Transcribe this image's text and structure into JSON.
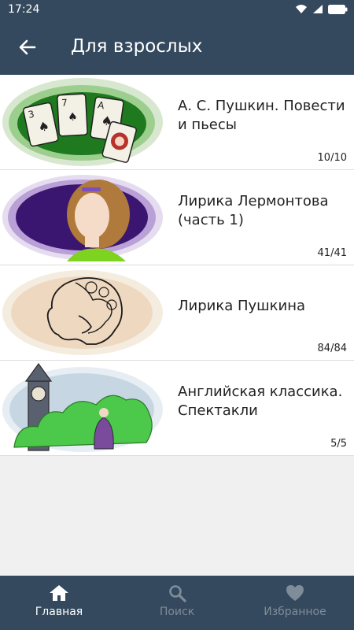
{
  "status_bar": {
    "time": "17:24"
  },
  "app_bar": {
    "title": "Для взрослых"
  },
  "items": [
    {
      "title": "А. С. Пушкин. Повести и пьесы",
      "count": "10/10",
      "image": "playing-cards-illustration"
    },
    {
      "title": "Лирика Лермонтова (часть 1)",
      "count": "41/41",
      "image": "woman-portrait-illustration"
    },
    {
      "title": "Лирика Пушкина",
      "count": "84/84",
      "image": "pushkin-profile-sketch"
    },
    {
      "title": "Английская классика. Спектакли",
      "count": "5/5",
      "image": "big-ben-garden-illustration"
    }
  ],
  "nav": [
    {
      "label": "Главная",
      "icon": "home-icon",
      "active": true
    },
    {
      "label": "Поиск",
      "icon": "search-icon",
      "active": false
    },
    {
      "label": "Избранное",
      "icon": "heart-icon",
      "active": false
    }
  ],
  "colors": {
    "bar": "#34495e",
    "background": "#f0f0f0",
    "inactive_nav": "#7f8c99"
  }
}
